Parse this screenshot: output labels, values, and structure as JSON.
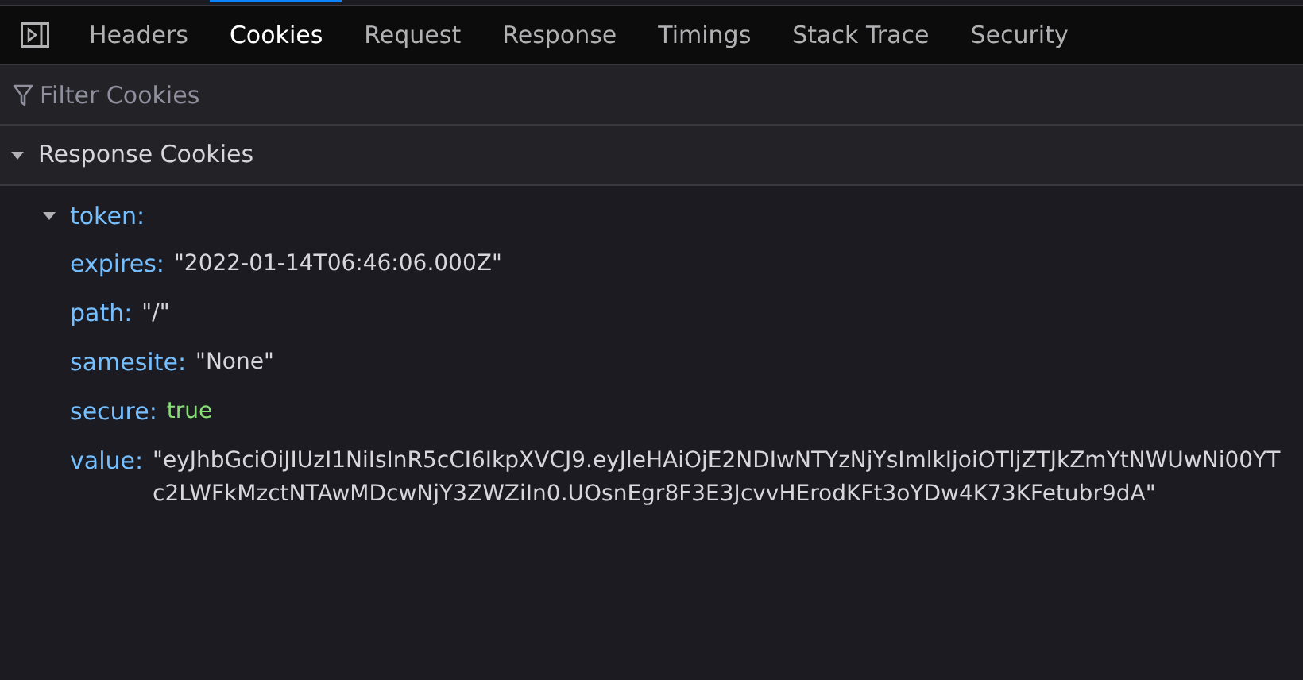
{
  "tabs": [
    {
      "label": "Headers",
      "selected": false
    },
    {
      "label": "Cookies",
      "selected": true
    },
    {
      "label": "Request",
      "selected": false
    },
    {
      "label": "Response",
      "selected": false
    },
    {
      "label": "Timings",
      "selected": false
    },
    {
      "label": "Stack Trace",
      "selected": false
    },
    {
      "label": "Security",
      "selected": false
    }
  ],
  "filter": {
    "placeholder": "Filter Cookies"
  },
  "section": {
    "title": "Response Cookies",
    "expanded": true,
    "cookies": [
      {
        "name": "token:",
        "expanded": true,
        "properties": [
          {
            "key": "expires:",
            "value": "\"2022-01-14T06:46:06.000Z\"",
            "kind": "string"
          },
          {
            "key": "path:",
            "value": "\"/\"",
            "kind": "string"
          },
          {
            "key": "samesite:",
            "value": "\"None\"",
            "kind": "string"
          },
          {
            "key": "secure:",
            "value": "true",
            "kind": "boolean"
          },
          {
            "key": "value:",
            "value": "\"eyJhbGciOiJIUzI1NiIsInR5cCI6IkpXVCJ9.eyJleHAiOjE2NDIwNTYzNjYsImlkIjoiOTljZTJkZmYtNWUwNi00YTc2LWFkMzctNTAwMDcwNjY3ZWZiIn0.UOsnEgr8F3E3JcvvHErodKFt3oYDw4K73KFetubr9dA\"",
            "kind": "string"
          }
        ]
      }
    ]
  }
}
